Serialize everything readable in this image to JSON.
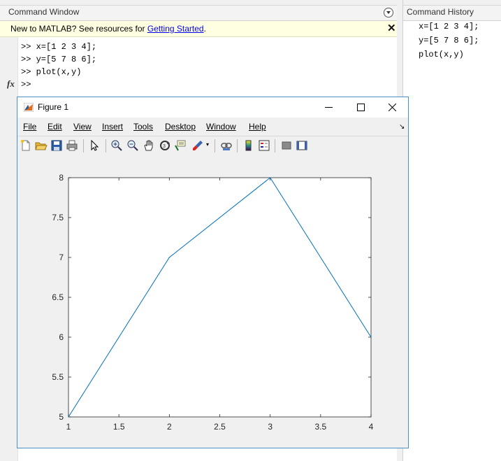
{
  "command_window": {
    "title": "Command Window",
    "banner": {
      "prefix": "New to MATLAB? See resources for ",
      "link": "Getting Started",
      "suffix": "."
    },
    "lines": [
      ">> x=[1 2 3 4];",
      ">> y=[5 7 8 6];",
      ">> plot(x,y)",
      ">>"
    ],
    "fx_label": "fx"
  },
  "command_history": {
    "title": "Command History",
    "items": [
      "x=[1 2 3 4];",
      "y=[5 7 8 6];",
      "plot(x,y)"
    ]
  },
  "figure": {
    "title": "Figure 1",
    "menus": [
      "File",
      "Edit",
      "View",
      "Insert",
      "Tools",
      "Desktop",
      "Window",
      "Help"
    ],
    "toolbar_icons": [
      "new-figure-icon",
      "open-file-icon",
      "save-icon",
      "print-icon",
      "edit-plot-icon",
      "zoom-in-icon",
      "zoom-out-icon",
      "pan-icon",
      "rotate-3d-icon",
      "data-cursor-icon",
      "brush-icon",
      "link-plot-icon",
      "colorbar-icon",
      "legend-icon",
      "hide-plot-tools-icon",
      "show-plot-tools-icon"
    ]
  },
  "colors": {
    "line": "#0072bd",
    "link": "#0000ee",
    "banner_bg": "#ffffe1",
    "figure_border": "#4a90c8"
  },
  "chart_data": {
    "type": "line",
    "x": [
      1,
      2,
      3,
      4
    ],
    "series": [
      {
        "values": [
          5,
          7,
          8,
          6
        ]
      }
    ],
    "xlim": [
      1,
      4
    ],
    "ylim": [
      5,
      8
    ],
    "xticks": [
      "1",
      "1.5",
      "2",
      "2.5",
      "3",
      "3.5",
      "4"
    ],
    "yticks": [
      "5",
      "5.5",
      "6",
      "6.5",
      "7",
      "7.5",
      "8"
    ],
    "title": "",
    "xlabel": "",
    "ylabel": "",
    "grid": false
  }
}
